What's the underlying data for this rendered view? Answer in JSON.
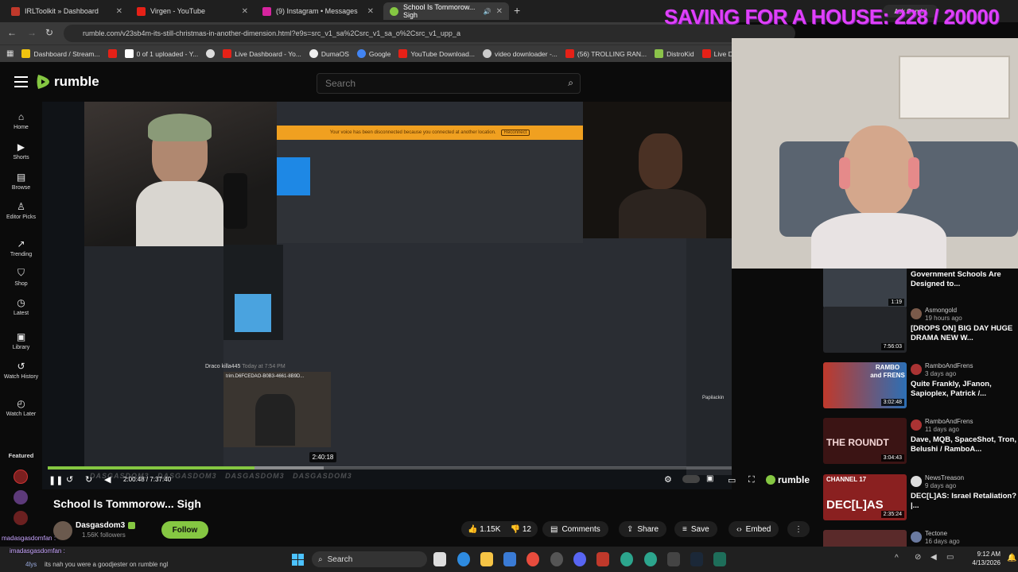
{
  "overlay": {
    "goal_text": "SAVING FOR A HOUSE: 228 / 20000",
    "ask_gemini": "Ask Gemini"
  },
  "tabs": [
    {
      "title": "IRLToolkit » Dashboard",
      "color": "#c0392b"
    },
    {
      "title": "Virgen - YouTube",
      "color": "#e62117"
    },
    {
      "title": "(9) Instagram • Messages",
      "color": "#d6249f"
    },
    {
      "title": "School Is Tommorow... Sigh",
      "color": "#85c742"
    }
  ],
  "address": {
    "url": "rumble.com/v23sb4m-its-still-christmas-in-another-dimension.html?e9s=src_v1_sa%2Csrc_v1_sa_o%2Csrc_v1_upp_a"
  },
  "bookmarks": [
    "Dashboard / Stream...",
    "",
    "0 of 1 uploaded - Y...",
    "",
    "Live Dashboard - Yo...",
    "DumaOS",
    "Google",
    "YouTube Download...",
    "video downloader -...",
    "(56) TROLLING RAN...",
    "DistroKid",
    "Live D"
  ],
  "rumble": {
    "logo": "rumble",
    "search_placeholder": "Search"
  },
  "sidebar": [
    {
      "label": "Home",
      "icon": "home-icon"
    },
    {
      "label": "Shorts",
      "icon": "shorts-icon"
    },
    {
      "label": "Browse",
      "icon": "browse-icon"
    },
    {
      "label": "Editor Picks",
      "icon": "editor-picks-icon"
    },
    {
      "label": "Trending",
      "icon": "trending-icon"
    },
    {
      "label": "Shop",
      "icon": "shop-icon"
    },
    {
      "label": "Latest",
      "icon": "latest-icon"
    },
    {
      "label": "Library",
      "icon": "library-icon"
    },
    {
      "label": "Watch History",
      "icon": "history-icon"
    },
    {
      "label": "Watch Later",
      "icon": "watch-later-icon"
    }
  ],
  "sidebar_featured": "Featured",
  "player": {
    "tooltip_time": "2:40:18",
    "current_time": "2:00:48",
    "total_time": "7:37:40",
    "time_display": "2:00:48 / 7:37:40",
    "progress_fraction": 0.27,
    "hover_fraction": 0.36,
    "brand": "rumble"
  },
  "video_meta": {
    "title": "School Is Tommorow... Sigh",
    "channel": "Dasgasdom3",
    "followers": "1.56K followers",
    "follow_label": "Follow",
    "likes": "1.15K",
    "dislikes": "12",
    "comments_label": "Comments",
    "share_label": "Share",
    "save_label": "Save",
    "embed_label": "Embed"
  },
  "stream_scene": {
    "banner": "Your voice has been disconnected because you connected at another location.",
    "reconnect": "Reconnect",
    "msg_user": "Draco killa445",
    "msg_time": "Today at 7:54 PM",
    "msg_file": "trim.D6FCEDAO-B0B3-4661-8B9D...",
    "right_label": "Papilackin",
    "watermark": "DASGASDOM3"
  },
  "chat_overlay": {
    "line1": "madasgasdomfan :",
    "line2": "imadasgasdomfan :",
    "line3": "its nah you were a goodjester on rumble ngl",
    "user3": "4lys"
  },
  "recommendations": [
    {
      "title": "Government Schools Are Designed to...",
      "channel": "",
      "ago": "",
      "duration": "1:19"
    },
    {
      "title": "[DROPS ON] BIG DAY HUGE DRAMA NEW W...",
      "channel": "Asmongold",
      "ago": "19 hours ago",
      "duration": "7:56:03"
    },
    {
      "title": "Quite Frankly, JFanon, Sapioplex, Patrick /...",
      "channel": "RamboAndFrens",
      "ago": "3 days ago",
      "duration": "3:02:48"
    },
    {
      "title": "Dave, MQB, SpaceShot, Tron, Belushi / RamboA...",
      "channel": "RamboAndFrens",
      "ago": "11 days ago",
      "duration": "3:04:43"
    },
    {
      "title": "DEC[L]AS: Israel Retaliation? |...",
      "channel": "NewsTreason",
      "ago": "9 days ago",
      "duration": "2:35:24"
    },
    {
      "title": "",
      "channel": "Tectone",
      "ago": "16 days ago",
      "duration": ""
    }
  ],
  "rec_thumb_text": {
    "rambo": "RAMBO and FRENS",
    "roundtable": "THE ROUNDT",
    "channel17": "CHANNEL 17",
    "declas": "DEC[L]AS"
  },
  "taskbar": {
    "search": "Search",
    "time": "9:12 AM",
    "date": "4/13/2026"
  },
  "colors": {
    "accent": "#85c742",
    "goal": "#e040fb",
    "bg": "#0b0b0b"
  }
}
